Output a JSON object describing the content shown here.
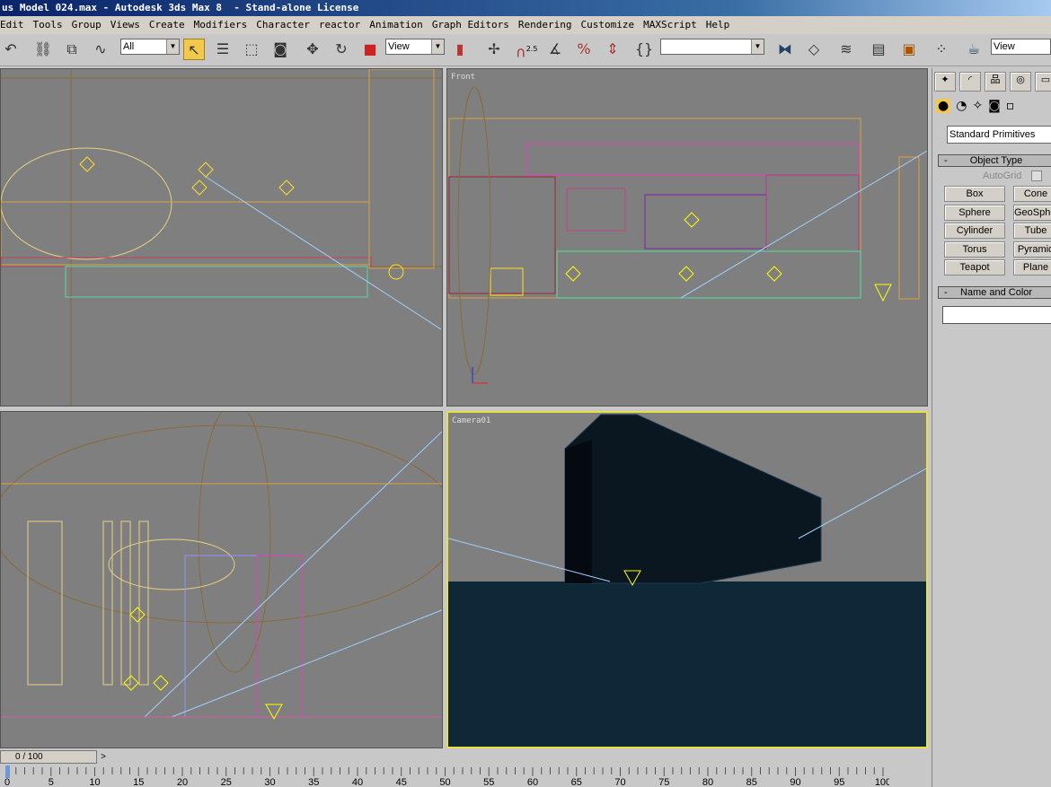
{
  "window": {
    "title": "us Model 024.max - Autodesk 3ds Max 8  - Stand-alone License"
  },
  "menu": [
    "Edit",
    "Tools",
    "Group",
    "Views",
    "Create",
    "Modifiers",
    "Character",
    "reactor",
    "Animation",
    "Graph Editors",
    "Rendering",
    "Customize",
    "MAXScript",
    "Help"
  ],
  "toolbar": {
    "selection_filter": "All",
    "ref_coord": "View",
    "named_selection": "",
    "view_dropdown": "View",
    "snap_angle_label": "2.5",
    "icons": [
      "undo-icon",
      "select-and-link-icon",
      "unlink-icon",
      "bind-space-warp-icon",
      "select-object-icon",
      "select-by-name-icon",
      "rectangular-selection-icon",
      "window-crossing-icon",
      "select-and-move-icon",
      "select-and-rotate-icon",
      "select-and-scale-icon",
      "use-pivot-icon",
      "manipulate-icon",
      "snap-toggle-icon",
      "angle-snap-icon",
      "percent-snap-icon",
      "spinner-snap-icon",
      "edit-named-selections-icon",
      "mirror-icon",
      "align-icon",
      "layer-manager-icon",
      "curve-editor-icon",
      "schematic-view-icon",
      "material-editor-icon",
      "render-scene-icon"
    ]
  },
  "viewports": {
    "top_left": "",
    "front": "Front",
    "left": "",
    "camera": "Camera01"
  },
  "command_panel": {
    "tabs": [
      "create-tab",
      "modify-tab",
      "hierarchy-tab",
      "motion-tab",
      "display-tab"
    ],
    "categories": [
      "geometry",
      "shapes",
      "lights",
      "cameras",
      "helpers"
    ],
    "dropdown": "Standard Primitives",
    "object_type": {
      "title": "Object Type",
      "autogrid": "AutoGrid",
      "buttons": [
        "Box",
        "Cone",
        "Sphere",
        "GeoSphere",
        "Cylinder",
        "Tube",
        "Torus",
        "Pyramid",
        "Teapot",
        "Plane"
      ]
    },
    "name_color": {
      "title": "Name and Color",
      "value": ""
    },
    "collapse": "-"
  },
  "timeline": {
    "slider": "0 / 100",
    "next": ">",
    "current_frame": 0,
    "ticks": [
      "0",
      "5",
      "10",
      "15",
      "20",
      "25",
      "30",
      "35",
      "40",
      "45",
      "50",
      "55",
      "60",
      "65",
      "70",
      "75",
      "80",
      "85",
      "90",
      "95",
      "100"
    ]
  }
}
